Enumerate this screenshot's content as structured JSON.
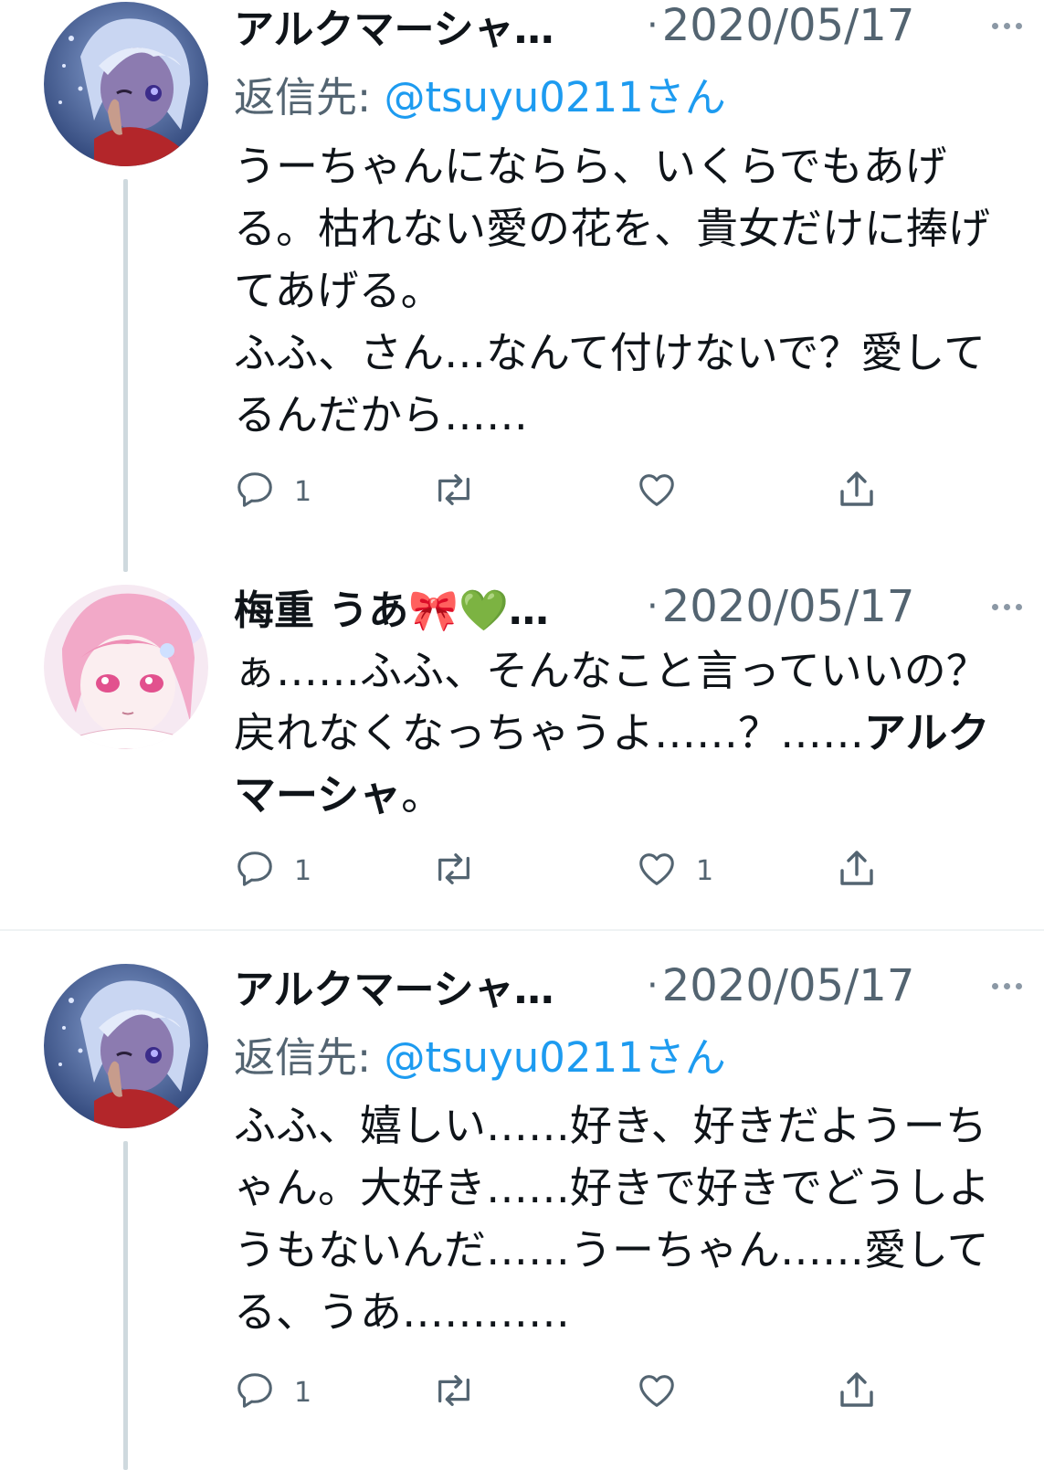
{
  "tweets": [
    {
      "name": "アルクマーシャ…",
      "dot": "·",
      "date": "2020/05/17",
      "reply_prefix": "返信先: ",
      "reply_handle": "@tsuyu0211さん",
      "text": "うーちゃんにならら、いくらでもあげる。枯れない愛の花を、貴女だけに捧げてあげる。\nふふ、さん…なんて付けないで？愛してるんだから……",
      "stats": {
        "reply": "1",
        "retweet": "",
        "like": ""
      }
    },
    {
      "name": "梅重 うあ🎀💚…",
      "dot": "·",
      "date": "2020/05/17",
      "text_prefix": "ぁ……ふふ、そんなこと言っていいの？戻れなくなっちゃうよ……？……",
      "text_bold": "アルクマーシャ",
      "text_suffix": "。",
      "stats": {
        "reply": "1",
        "retweet": "",
        "like": "1"
      }
    },
    {
      "name": "アルクマーシャ…",
      "dot": "·",
      "date": "2020/05/17",
      "reply_prefix": "返信先: ",
      "reply_handle": "@tsuyu0211さん",
      "text": "ふふ、嬉しい……好き、好きだようーちゃん。大好き……好きで好きでどうしようもないんだ……うーちゃん……愛してる、うあ…………",
      "stats": {
        "reply": "1",
        "retweet": "",
        "like": ""
      }
    }
  ],
  "icons": {
    "reply": "reply-icon",
    "retweet": "retweet-icon",
    "like": "heart-icon",
    "share": "share-icon",
    "more": "more-icon"
  },
  "colors": {
    "text": "#0f1419",
    "secondary": "#536471",
    "link": "#1d9bf0",
    "thread_line": "#cfd9de",
    "divider": "#eff3f4"
  }
}
